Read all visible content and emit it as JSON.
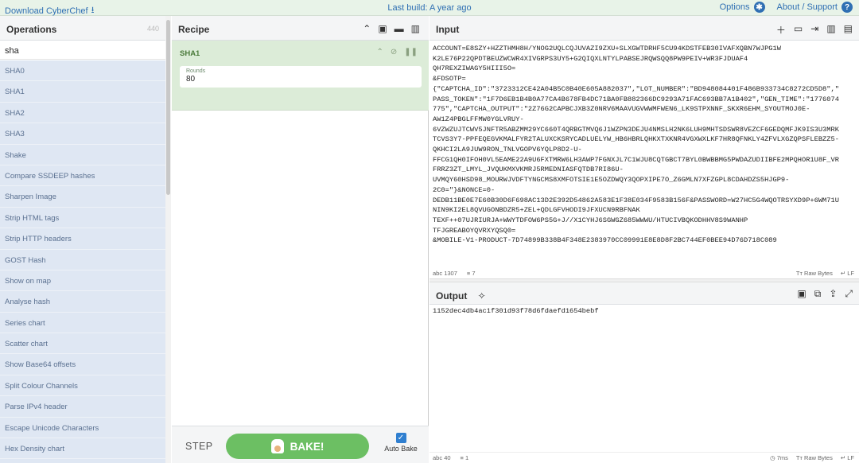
{
  "topbar": {
    "download": "Download CyberChef",
    "last_build": "Last build: A year ago",
    "options": "Options",
    "about": "About / Support"
  },
  "operations": {
    "title": "Operations",
    "count": "440",
    "search_value": "sha",
    "items": [
      "SHA0",
      "SHA1",
      "SHA2",
      "SHA3",
      "Shake",
      "Compare SSDEEP hashes",
      "Sharpen Image",
      "Strip HTML tags",
      "Strip HTTP headers",
      "GOST Hash",
      "Show on map",
      "Analyse hash",
      "Series chart",
      "Scatter chart",
      "Show Base64 offsets",
      "Split Colour Channels",
      "Parse IPv4 header",
      "Escape Unicode Characters",
      "Hex Density chart"
    ]
  },
  "recipe": {
    "title": "Recipe",
    "op_name": "SHA1",
    "arg_label": "Rounds",
    "arg_value": "80",
    "step_label": "STEP",
    "bake_label": "BAKE!",
    "autobake_label": "Auto Bake"
  },
  "input": {
    "title": "Input",
    "text": "ACCOUNT=E8SZY+HZZTHMH8H/YNOG2UQLCQJUVAZI9ZXU+SLXGWTDRHF5CU94KDSTFEB30IVAFXQBN7WJPG1W\nK2LE76P22QPDTBEUZWCWR4XIVGRPS3UY5+G2QIQXLNTYLPABSEJRQWSQQ8PW9PEIV+WR3FJDUAF4\nQH7REXZIWAGY5HIII5O=\n&FDSOTP=\n{\"CAPTCHA_ID\":\"3723312CE42A04B5C0B40E605A882037\",\"LOT_NUMBER\":\"BD948084401F486B933734C8272CD5D8\",\"\nPASS_TOKEN\":\"1F7D6EB1B4B0A77CA4B678FB4DC71BA0FB882366DC9293A71FAC693BB7A1B402\",\"GEN_TIME\":\"1776074\n775\",\"CAPTCHA_OUTPUT\":\"2Z76G2CAPBCJXB3Z0NRV6MAAVUGVWWMFWEN6_LK9STPXNNF_SKXR6EHM_SYOUTMOJ0E-\nAW1Z4PBGLFFMW0YGLVRUY-\n6VZWZUJTCWV5JNFTR5ABZMM29YC660T4QRBGTMVQ6J1WZPN3DEJU4NMSLH2NK6LUH9MHTSDSWR8VEZCF6GEDQMFJK9IS3U3MRK\nTCVS3Y7-PPFEQEGVKMALFYR2TALUXCKSRYCADLUELYW_HB6HBRLQHKXTXKNR4VGXWXLKF7HR8QFNKLY4ZFVLXGZQPSFLEBZZ5-\nQKHCI2LA9JUW9RON_TNLVGOPV6YQLP8D2-U-\nFFCG1QH0IFOH0VL5EAME22A9U6FXTMRW6LH3AWP7FGNXJL7C1WJU8CQTGBCT7BYL0BWBBMG5PWDAZUDIIBFE2MPQHOR1U8F_VR\nFRRZ3ZT_LMYL_JVQUKMXVKMRJ5RMEDNIASFQTDB7RI86U-\nUVMQY60HSD98_MOURWJVDFTYNGCMS8XMFOTSIE1E5OZDWQY3QOPXIPE7O_Z6GMLN7XFZGPL8CDAHDZS5HJGP9-\n2C0=\"}&NONCE=0-\nDEDB11BE0E7E60B30D6F698AC13D2E392D54862A583E1F38E034F9583B156F&PASSWORD=W27HC5G4WQOTRSYXD9P+6WM71U\nNIN9KI2EL8QVUGONBDZR5+ZEL+QDLGFVHODI9JFXUCN9RBFNAK\nTEXF++07UJRIURJA+WWYTDFOW6PS5G+J//X1CYHJ6SGWGZ685WWWU/HTUCIVBQKODHHV8S9WANHP\nTFJGREABOYQVRXYQSQ0=\n&MOBILE-V1-PRODUCT-7D74899B338B4F348E2383970CC09991E8E8D8F2BC744EF0BEE94D76D718C089",
    "chars": "1307",
    "lines": "7",
    "raw_bytes": "Raw Bytes",
    "eol": "LF"
  },
  "output": {
    "title": "Output",
    "text": "1152dec4db4ac1f301d93f78d6fdaefd1654bebf",
    "chars": "40",
    "lines": "1",
    "time": "7ms",
    "raw_bytes": "Raw Bytes",
    "eol": "LF"
  }
}
